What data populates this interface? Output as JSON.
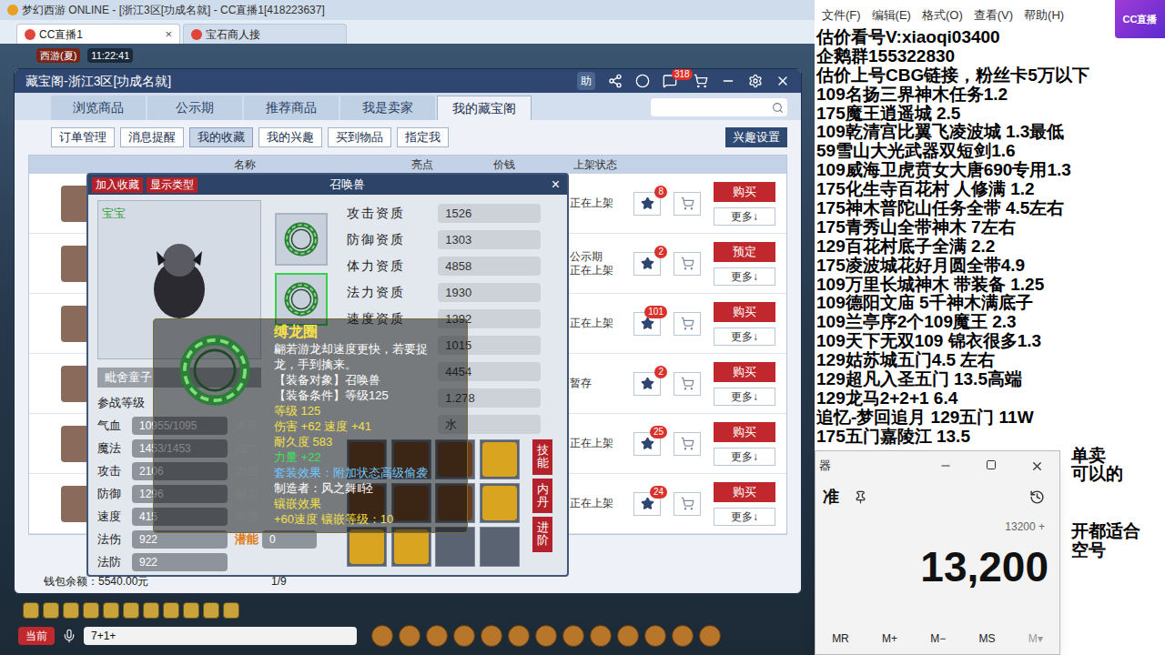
{
  "app": {
    "title": "梦幻西游 ONLINE - [浙江3区[功成名就] - CC直播1[418223637]"
  },
  "browser_tabs": [
    {
      "label": "CC直播1",
      "selected": true
    },
    {
      "label": "宝石商人接",
      "selected": false
    }
  ],
  "tab_close": "×",
  "hud": {
    "map": "西游(夏)",
    "time": "11:22:41"
  },
  "cbg": {
    "title": "藏宝阁-浙江3区[功成名就]",
    "help": "助",
    "message_badge": "318",
    "tabs": [
      {
        "label": "浏览商品",
        "selected": false
      },
      {
        "label": "公示期",
        "selected": false
      },
      {
        "label": "推荐商品",
        "selected": false
      },
      {
        "label": "我是卖家",
        "selected": false
      },
      {
        "label": "我的藏宝阁",
        "selected": true
      }
    ],
    "subtabs": [
      {
        "label": "订单管理",
        "selected": false
      },
      {
        "label": "消息提醒",
        "selected": false
      },
      {
        "label": "我的收藏",
        "selected": true
      },
      {
        "label": "我的兴趣",
        "selected": false
      },
      {
        "label": "买到物品",
        "selected": false
      },
      {
        "label": "指定我",
        "selected": false
      }
    ],
    "interest_button": "兴趣设置",
    "columns": [
      "名称",
      "亮点",
      "价钱",
      "上架状态"
    ],
    "rows": [
      {
        "status": [
          "正在上架"
        ],
        "likes": "8",
        "action": "购买",
        "more": "更多↓"
      },
      {
        "status": [
          "公示期",
          "正在上架"
        ],
        "likes": "2",
        "action": "预定",
        "more": "更多↓"
      },
      {
        "status": [
          "正在上架"
        ],
        "likes": "101",
        "action": "购买",
        "more": "更多↓"
      },
      {
        "status": [
          "暂存"
        ],
        "likes": "2",
        "action": "购买",
        "more": "更多↓"
      },
      {
        "status": [
          "正在上架"
        ],
        "likes": "25",
        "action": "购买",
        "more": "更多↓"
      },
      {
        "status": [
          "正在上架"
        ],
        "likes": "24",
        "action": "购买",
        "more": "更多↓"
      }
    ],
    "wallet": "钱包余额：5540.00元",
    "page": "1/9"
  },
  "pet": {
    "title": "召唤兽",
    "add_fav": "加入收藏",
    "show_type": "显示类型",
    "close": "×",
    "kind": "宝宝",
    "name": "毗舍童子",
    "equip": [
      {
        "selected": false
      },
      {
        "selected": true
      }
    ],
    "left_stats": [
      {
        "label": "参战等级"
      },
      {
        "label": "气血",
        "value": "10955/1095"
      },
      {
        "label": "魔法",
        "value": "1453/1453"
      },
      {
        "label": "攻击",
        "value": "2106"
      },
      {
        "label": "防御",
        "value": "1296"
      },
      {
        "label": "速度",
        "value": "415"
      },
      {
        "label": "法伤",
        "value": "922"
      },
      {
        "label": "法防",
        "value": "922"
      }
    ],
    "mid_stats": [
      "体质",
      "法力",
      "力量",
      "耐力",
      "敏捷"
    ],
    "potential": {
      "label": "潜能",
      "value": "0"
    },
    "aptitudes": [
      {
        "label": "攻击资质",
        "value": "1526"
      },
      {
        "label": "防御资质",
        "value": "1303"
      },
      {
        "label": "体力资质",
        "value": "4858"
      },
      {
        "label": "法力资质",
        "value": "1930"
      },
      {
        "label": "速度资质",
        "value": "1392"
      },
      {
        "value": "1015"
      },
      {
        "value": "4454"
      },
      {
        "value": "1.278"
      },
      {
        "value": "水"
      }
    ],
    "skills": [
      {
        "filled": true,
        "color": "#6b3f1d"
      },
      {
        "filled": true,
        "color": "#6b3f1d"
      },
      {
        "filled": true,
        "color": "#6b3f1d"
      },
      {
        "filled": true,
        "color": "#d9a520"
      },
      {
        "filled": true,
        "color": "#6b3f1d"
      },
      {
        "filled": true,
        "color": "#6b3f1d"
      },
      {
        "filled": true,
        "color": "#6b3f1d"
      },
      {
        "filled": true,
        "color": "#d9a520"
      },
      {
        "filled": true,
        "color": "#d9a520"
      },
      {
        "filled": true,
        "color": "#d9a520"
      },
      {
        "filled": false
      },
      {
        "filled": false
      }
    ],
    "side_buttons": [
      "技能",
      "内丹",
      "进阶"
    ]
  },
  "tooltip": {
    "name": "缚龙圈",
    "lines": [
      {
        "text": "翩若游龙却速度更快，若要捉",
        "color": "#ffffff"
      },
      {
        "text": "龙，手到擒来。",
        "color": "#ffffff"
      },
      {
        "text": "【装备对象】召唤兽",
        "color": "#ffffff"
      },
      {
        "text": "【装备条件】等级125",
        "color": "#ffffff"
      },
      {
        "text": "等级 125",
        "color": "#f4e04a"
      },
      {
        "text": "伤害 +62 速度 +41",
        "color": "#f4e04a"
      },
      {
        "text": "耐久度 583",
        "color": "#f4e04a"
      },
      {
        "text": "力量 +22",
        "color": "#3fe05a"
      },
      {
        "text": "套装效果：附加状态高级偷袭",
        "color": "#6fc8ff"
      },
      {
        "text": "制造者：风之舞‖轻",
        "color": "#ffffff"
      },
      {
        "text": "镶嵌效果",
        "color": "#f4e04a"
      },
      {
        "text": "+60速度 镶嵌等级：10",
        "color": "#f4e04a"
      }
    ]
  },
  "chat": {
    "channel": "当前",
    "input": "7+1+"
  },
  "notepad": {
    "menu": [
      "文件(F)",
      "编辑(E)",
      "格式(O)",
      "查看(V)",
      "帮助(H)"
    ],
    "lines": [
      {
        "text": "估价看号V:xiaoqi03400",
        "kind": "full"
      },
      {
        "text": "企鹅群155322830",
        "kind": "full"
      },
      {
        "text": "估价上号CBG链接，粉丝卡5万以下",
        "kind": "full"
      },
      {
        "text": "109名扬三界神木任务1.2",
        "kind": "full"
      },
      {
        "text": "175魔王逍遥城 2.5",
        "kind": "full"
      },
      {
        "text": "109乾清宫比翼飞凌波城 1.3最低",
        "kind": "full"
      },
      {
        "text": "59雪山大光武器双短剑1.6",
        "kind": "full"
      },
      {
        "text": "109威海卫虎贲女大唐690专用1.3",
        "kind": "full"
      },
      {
        "text": "175化生寺百花村 人修满 1.2",
        "kind": "full"
      },
      {
        "text": "175神木普陀山任务全带 4.5左右",
        "kind": "full"
      },
      {
        "text": "175青秀山全带神木  7左右",
        "kind": "full"
      },
      {
        "text": "129百花村底子全满 2.2",
        "kind": "full"
      },
      {
        "text": "175凌波城花好月圆全带4.9",
        "kind": "full"
      },
      {
        "text": "109万里长城神木 带装备  1.25",
        "kind": "full"
      },
      {
        "text": "109德阳文庙 5千神木满底子",
        "kind": "full"
      },
      {
        "text": "109兰亭序2个109魔王 2.3",
        "kind": "full"
      },
      {
        "text": "109天下无双109  锦衣很多1.3",
        "kind": "full"
      },
      {
        "text": "129姑苏城五门4.5 左右",
        "kind": "full"
      },
      {
        "text": "129超凡入圣五门  13.5高端",
        "kind": "full"
      },
      {
        "text": "129龙马2+2+1  6.4",
        "kind": "full"
      },
      {
        "text": "追忆-梦回追月 129五门 11W",
        "kind": "full"
      },
      {
        "text": "175五门嘉陵江 13.5",
        "kind": "full"
      },
      {
        "text": "单卖",
        "kind": "cut"
      },
      {
        "text": "可以的",
        "kind": "cut"
      },
      {
        "text": "",
        "kind": "blank"
      },
      {
        "text": "",
        "kind": "blank"
      },
      {
        "text": "开都适合",
        "kind": "cut"
      },
      {
        "text": "空号",
        "kind": "cut"
      }
    ]
  },
  "cc_logo": "CC直播",
  "calculator": {
    "title": "器",
    "mode": "准",
    "history": "13200 +",
    "display": "13,200",
    "memory": [
      {
        "label": "MR",
        "disabled": false
      },
      {
        "label": "M+",
        "disabled": false
      },
      {
        "label": "M−",
        "disabled": false
      },
      {
        "label": "MS",
        "disabled": false
      },
      {
        "label": "M▾",
        "disabled": true
      }
    ]
  }
}
